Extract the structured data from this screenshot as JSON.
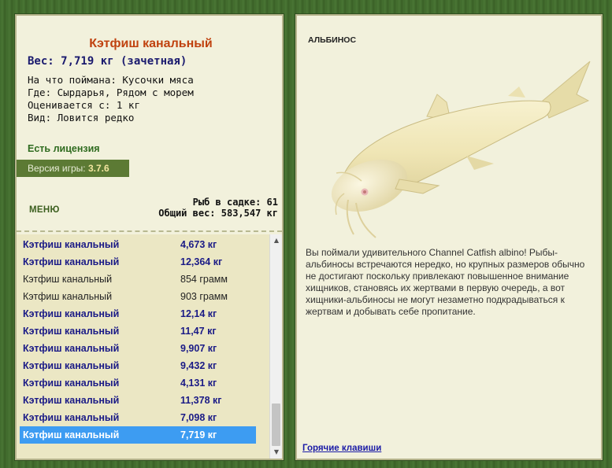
{
  "fish": {
    "title": "Кэтфиш канальный",
    "weight": "Вес: 7,719 кг (зачетная)",
    "bait": "На что поймана: Кусочки мяса",
    "location": "Где: Сырдарья, Рядом с морем",
    "rated_from": "Оценивается с: 1 кг",
    "rarity": "Вид: Ловится редко"
  },
  "license": "Есть лицензия",
  "version": {
    "label": "Версия игры: ",
    "value": "3.7.6"
  },
  "menu_label": "МЕНЮ",
  "keepnet": {
    "count": "Рыб в садке: 61",
    "total_weight": "Общий вес: 583,547 кг"
  },
  "catches": [
    {
      "name": "Кэтфиш канальный",
      "weight": "4,673 кг",
      "style": "bold"
    },
    {
      "name": "Кэтфиш канальный",
      "weight": "12,364 кг",
      "style": "bold"
    },
    {
      "name": "Кэтфиш канальный",
      "weight": "854 грамм",
      "style": "plain"
    },
    {
      "name": "Кэтфиш канальный",
      "weight": "903 грамм",
      "style": "plain"
    },
    {
      "name": "Кэтфиш канальный",
      "weight": "12,14 кг",
      "style": "bold"
    },
    {
      "name": "Кэтфиш канальный",
      "weight": "11,47 кг",
      "style": "bold"
    },
    {
      "name": "Кэтфиш канальный",
      "weight": "9,907 кг",
      "style": "bold"
    },
    {
      "name": "Кэтфиш канальный",
      "weight": "9,432 кг",
      "style": "bold"
    },
    {
      "name": "Кэтфиш канальный",
      "weight": "4,131 кг",
      "style": "bold"
    },
    {
      "name": "Кэтфиш канальный",
      "weight": "11,378 кг",
      "style": "bold"
    },
    {
      "name": "Кэтфиш канальный",
      "weight": "7,098 кг",
      "style": "bold"
    },
    {
      "name": "Кэтфиш канальный",
      "weight": "7,719 кг",
      "style": "selected"
    }
  ],
  "albino_label": "АЛЬБИНОС",
  "description": "Вы поймали удивительного Channel Catfish albino! Рыбы-альбиносы встречаются нередко, но крупных размеров обычно не достигают поскольку привлекают повышенное внимание хищников, становясь их жертвами в первую очередь, а вот хищники-альбиносы не могут незаметно подкрадываться к жертвам и добывать себе пропитание.",
  "hotkeys_link": "Горячие клавиши",
  "icons": {
    "scroll_up": "triangle-up-icon",
    "scroll_down": "triangle-down-icon",
    "fish_picture": "albino-catfish-illustration"
  }
}
